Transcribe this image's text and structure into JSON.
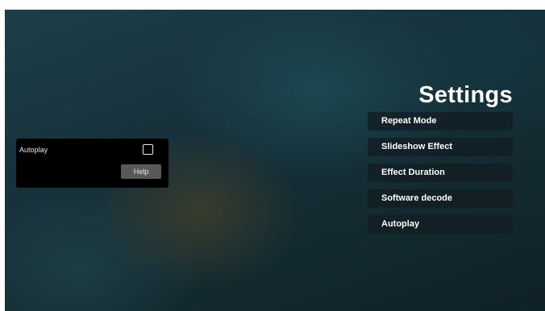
{
  "settings": {
    "title": "Settings",
    "menu_items": [
      {
        "label": "Repeat Mode"
      },
      {
        "label": "Slideshow Effect"
      },
      {
        "label": "Effect Duration"
      },
      {
        "label": "Software decode"
      },
      {
        "label": "Autoplay"
      }
    ]
  },
  "dialog": {
    "label": "Autoplay",
    "checked": false,
    "help_label": "Help"
  },
  "colors": {
    "menu_item_bg": "#121e24",
    "dialog_bg": "#000000",
    "help_button_bg": "#595959"
  }
}
